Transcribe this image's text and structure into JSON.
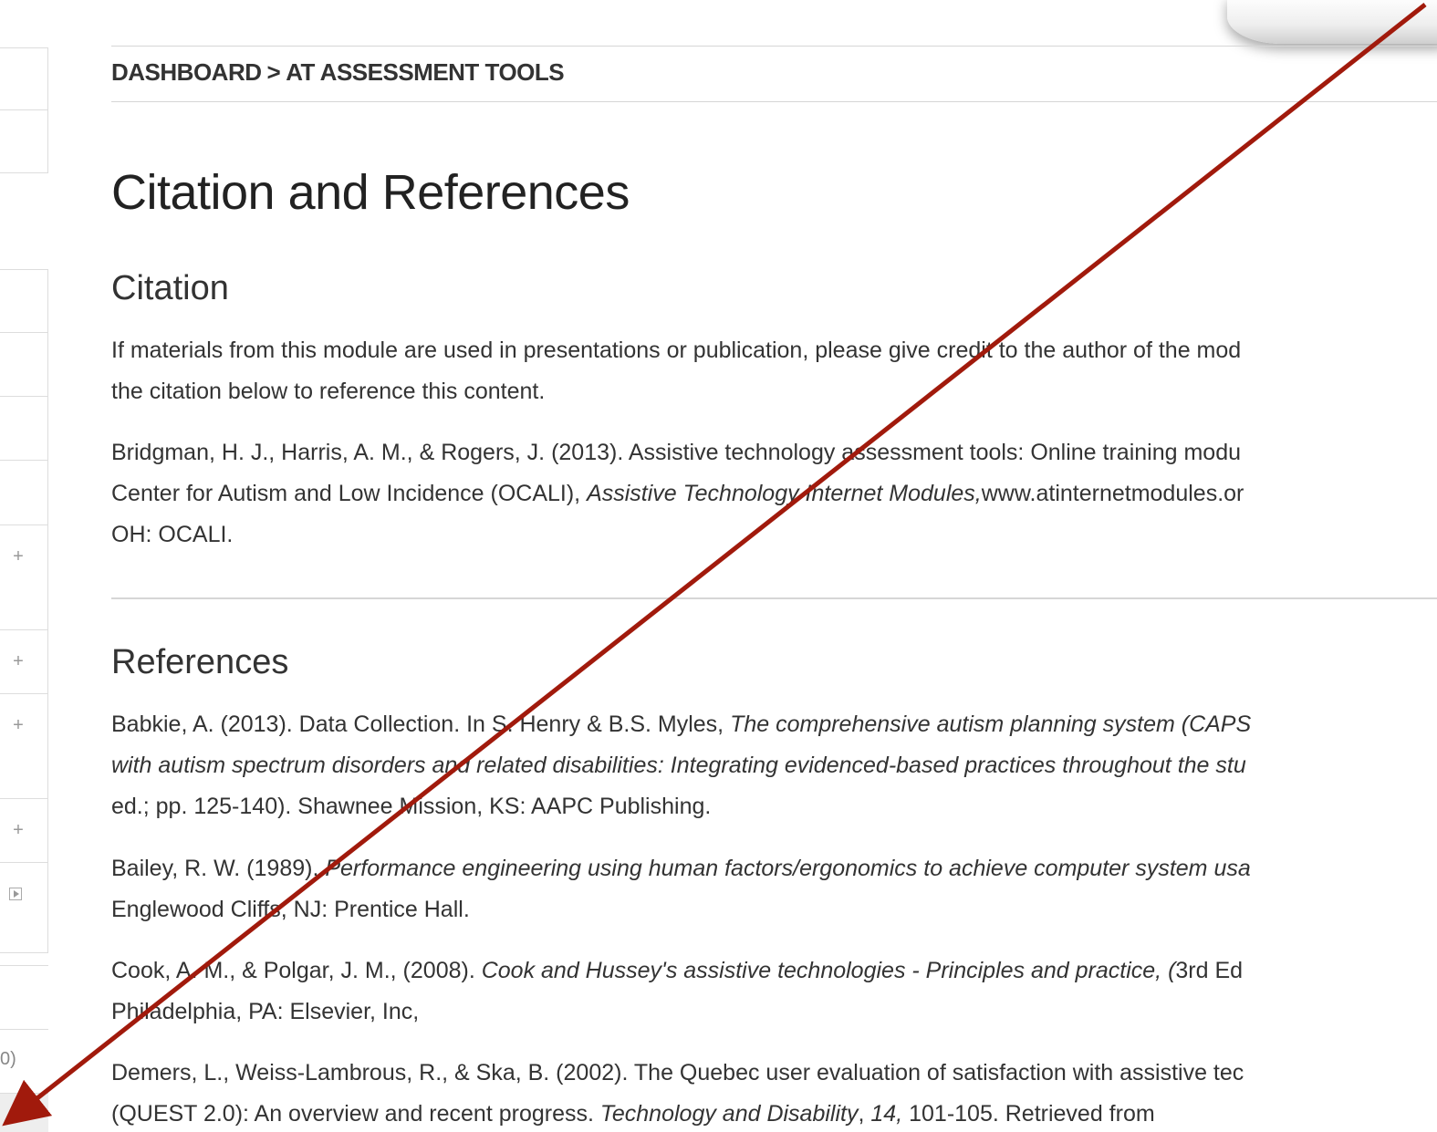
{
  "breadcrumb": {
    "home": "DASHBOARD",
    "separator": ">",
    "current": "AT ASSESSMENT TOOLS"
  },
  "page_title": "Citation and References",
  "citation": {
    "heading": "Citation",
    "intro_lines": [
      "If materials from this module are used in presentations or publication, please give credit to the author of the mod",
      "the citation below to reference this content."
    ],
    "reference": {
      "line1": "Bridgman, H. J., Harris, A. M., & Rogers, J. (2013). Assistive technology assessment tools: Online training modu",
      "line2_pre": "Center for Autism and Low Incidence (OCALI), ",
      "line2_em": "Assistive Technology Internet Modules,",
      "line2_post": "www.atinternetmodules.or",
      "line3": "OH: OCALI."
    }
  },
  "references": {
    "heading": "References",
    "items": [
      {
        "l1_pre": "Babkie, A. (2013). Data Collection. In S. Henry & B.S. Myles, ",
        "l1_em": "The comprehensive autism planning system (CAPS",
        "l2_em": "with autism spectrum disorders and related disabilities: Integrating evidenced-based practices throughout the stu",
        "l3": "ed.; pp. 125-140). Shawnee Mission, KS: AAPC Publishing."
      },
      {
        "l1_pre": "Bailey, R. W. (1989). ",
        "l1_em": "Performance engineering using human factors/ergonomics to achieve computer system usa",
        "l2": "Englewood Cliffs, NJ: Prentice Hall."
      },
      {
        "l1_pre": "Cook, A. M., & Polgar, J. M., (2008). ",
        "l1_em": "Cook and Hussey's assistive technologies - Principles and practice, (",
        "l1_post": "3rd Ed",
        "l2": "Philadelphia, PA: Elsevier, Inc,"
      },
      {
        "l1": "Demers, L., Weiss-Lambrous, R., & Ska, B. (2002). The Quebec user evaluation of satisfaction with assistive tec",
        "l2_pre": "(QUEST 2.0): An overview and recent progress. ",
        "l2_em": "Technology and Disability",
        "l2_mid": ", ",
        "l2_em2": "14,",
        "l2_post": " 101-105. Retrieved from"
      }
    ]
  },
  "sidebar": {
    "plus_symbol": "+",
    "cut_text": "0)"
  },
  "annotation": {
    "arrow_color": "#a11a0c"
  }
}
